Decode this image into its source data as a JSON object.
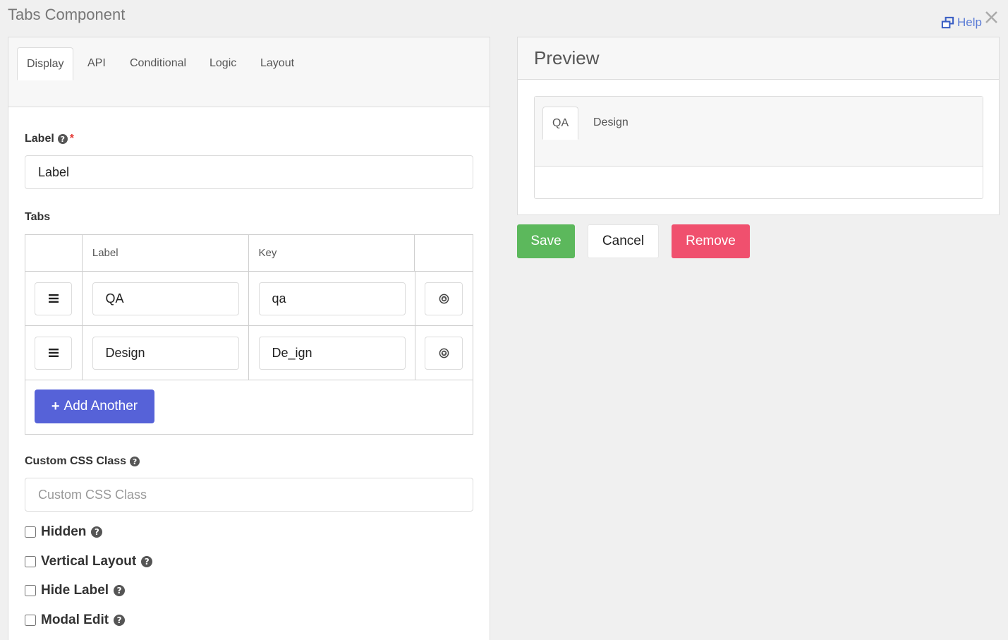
{
  "modal": {
    "title": "Tabs Component",
    "help_label": "Help"
  },
  "editor": {
    "tabs": [
      "Display",
      "API",
      "Conditional",
      "Logic",
      "Layout"
    ],
    "active_tab": "Display",
    "label_field": {
      "label": "Label",
      "value": "Label",
      "required": true
    },
    "tabs_section": {
      "label": "Tabs",
      "columns": [
        "Label",
        "Key"
      ],
      "rows": [
        {
          "label": "QA",
          "key": "qa"
        },
        {
          "label": "Design",
          "key": "De_ign"
        }
      ],
      "add_button": "Add Another"
    },
    "css_field": {
      "label": "Custom CSS Class",
      "placeholder": "Custom CSS Class",
      "value": ""
    },
    "checkboxes": [
      {
        "label": "Hidden",
        "checked": false
      },
      {
        "label": "Vertical Layout",
        "checked": false
      },
      {
        "label": "Hide Label",
        "checked": false
      },
      {
        "label": "Modal Edit",
        "checked": false
      }
    ]
  },
  "preview": {
    "title": "Preview",
    "tabs": [
      "QA",
      "Design"
    ],
    "active_tab": "QA"
  },
  "actions": {
    "save": "Save",
    "cancel": "Cancel",
    "remove": "Remove"
  },
  "colors": {
    "primary": "#5662d8",
    "success": "#5cb85c",
    "danger": "#f0506e",
    "link": "#5a7bd6"
  },
  "icons": {
    "help": "external-window-icon",
    "close": "close-icon",
    "question": "question-circle-icon",
    "drag": "bars-icon",
    "remove_row": "times-circle-icon",
    "add": "plus-icon"
  }
}
